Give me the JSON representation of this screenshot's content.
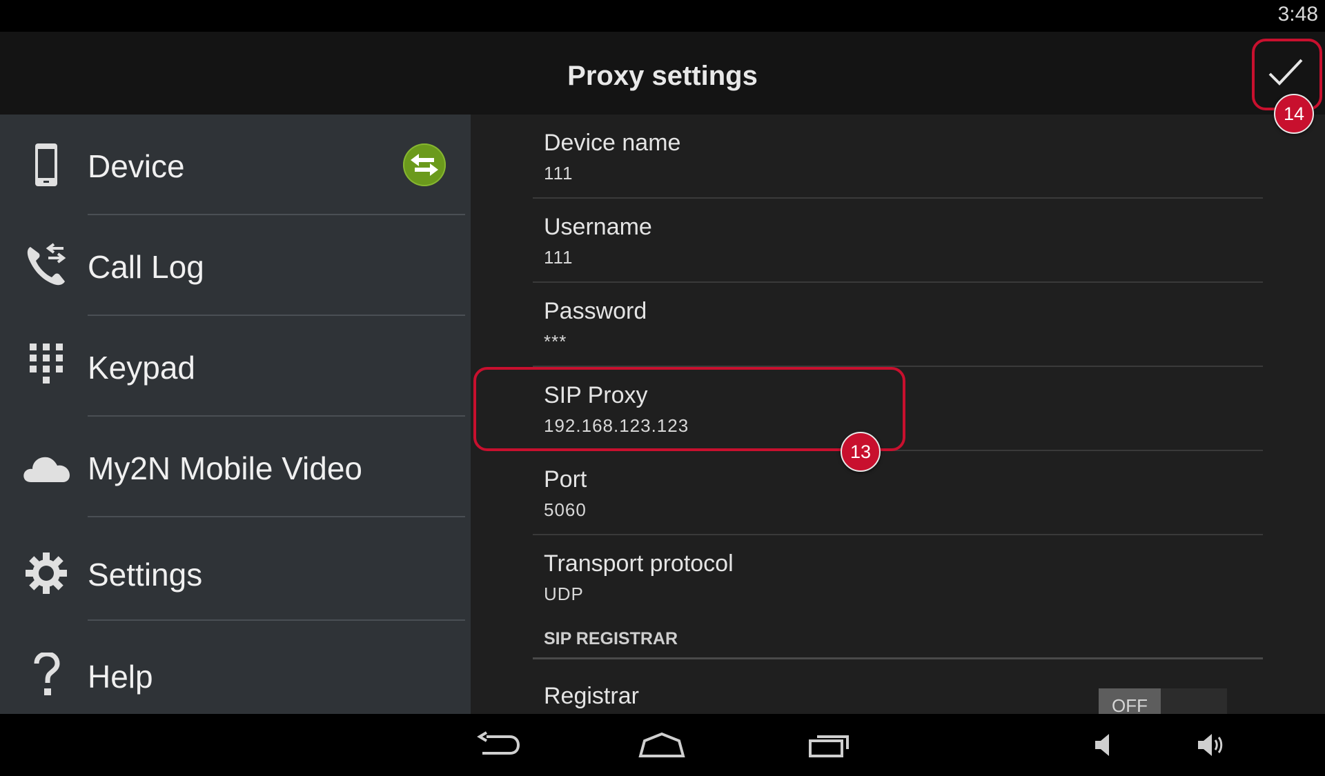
{
  "status_bar": {
    "time": "3:48"
  },
  "action_bar": {
    "title": "Proxy settings",
    "confirm_icon": "checkmark-icon"
  },
  "sidebar": {
    "items": [
      {
        "label": "Device",
        "icon": "phone-icon",
        "badge_icon": "sync-arrows-icon",
        "badge_color": "#6b9a1c"
      },
      {
        "label": "Call Log",
        "icon": "call-log-icon"
      },
      {
        "label": "Keypad",
        "icon": "keypad-icon"
      },
      {
        "label": "My2N Mobile Video",
        "icon": "cloud-icon"
      },
      {
        "label": "Settings",
        "icon": "gear-icon"
      },
      {
        "label": "Help",
        "icon": "question-mark-icon"
      }
    ]
  },
  "settings": {
    "fields": [
      {
        "title": "Device name",
        "value": "111"
      },
      {
        "title": "Username",
        "value": "111"
      },
      {
        "title": "Password",
        "value": "***"
      },
      {
        "title": "SIP Proxy",
        "value": "192.168.123.123"
      },
      {
        "title": "Port",
        "value": "5060"
      },
      {
        "title": "Transport protocol",
        "value": "UDP"
      }
    ],
    "section_header": "SIP REGISTRAR",
    "registrar": {
      "title": "Registrar",
      "toggle": "OFF"
    }
  },
  "annotations": [
    {
      "number": "13",
      "target": "SIP Proxy",
      "color": "#c8102e"
    },
    {
      "number": "14",
      "target": "confirm",
      "color": "#c8102e"
    }
  ],
  "nav_bar": {
    "icons": [
      "back-icon",
      "home-icon",
      "recent-apps-icon",
      "volume-down-icon",
      "volume-up-icon"
    ]
  }
}
